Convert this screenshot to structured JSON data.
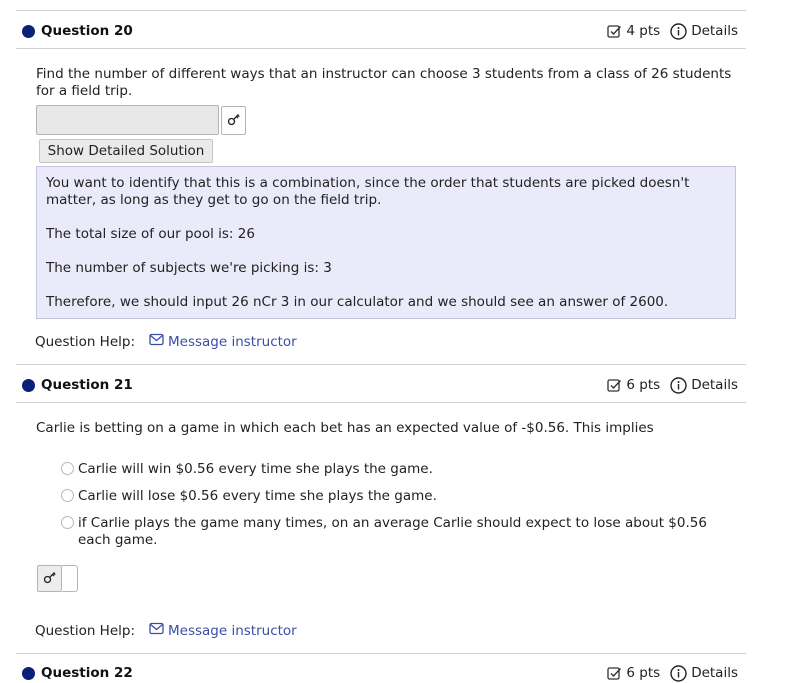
{
  "q20": {
    "title": "Question 20",
    "points": "4 pts",
    "details_label": "Details",
    "prompt": "Find the number of different ways that an instructor can choose 3 students from a class of 26 students for a field trip.",
    "answer_value": "",
    "show_solution_label": "Show Detailed Solution",
    "solution": [
      "You want to identify that this is a combination, since the order that students are picked doesn't matter, as long as they get to go on the field trip.",
      "The total size of our pool is: 26",
      "The number of subjects we're picking is: 3",
      "Therefore, we should input 26 nCr 3 in our calculator and we should see an answer of 2600."
    ],
    "help_label": "Question Help:",
    "message_label": "Message instructor"
  },
  "q21": {
    "title": "Question 21",
    "points": "6 pts",
    "details_label": "Details",
    "prompt": "Carlie is betting on a game in which each bet has an expected value of -$0.56. This implies",
    "options": [
      "Carlie will win $0.56 every time she plays the game.",
      "Carlie will lose $0.56 every time she plays the game.",
      "if Carlie plays the game many times, on an average Carlie should expect to lose about $0.56 each game."
    ],
    "help_label": "Question Help:",
    "message_label": "Message instructor"
  },
  "q22": {
    "title": "Question 22",
    "points": "6 pts",
    "details_label": "Details"
  },
  "icons": {
    "checkbox": "checkbox-icon",
    "info": "info-icon",
    "key": "key-icon",
    "mail": "mail-icon",
    "bullet": "question-bullet-icon"
  },
  "colors": {
    "bullet": "#0c1f7a",
    "link": "#3a4ea8",
    "solution_bg": "#eaeafb"
  }
}
